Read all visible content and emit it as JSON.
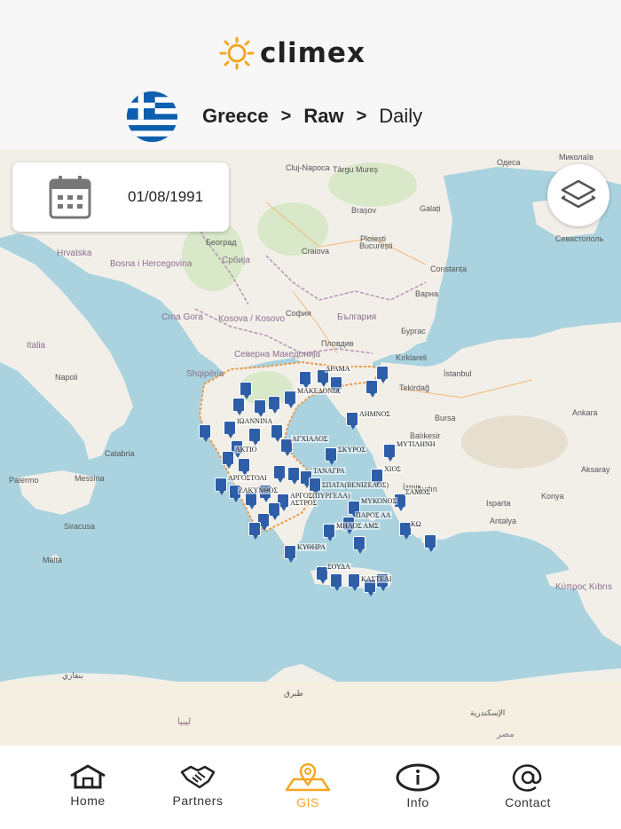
{
  "header": {
    "brand": "climex",
    "breadcrumb": {
      "country": "Greece",
      "source": "Raw",
      "frequency": "Daily",
      "separator": ">"
    }
  },
  "date_picker": {
    "value": "01/08/1991"
  },
  "map": {
    "labels": {
      "odesa": "Одеса",
      "mykolaiv": "Миколаїв",
      "sevastopol": "Севастополь",
      "cluj": "Cluj-Napoca",
      "tirgumures": "Târgu Mureș",
      "brasov": "Brașov",
      "galati": "Galați",
      "ploiesti": "Ploiești",
      "bucuresti": "București",
      "constanta": "Constanța",
      "craiova": "Craiova",
      "varna": "Варна",
      "sofia": "София",
      "bulgaria": "България",
      "plovdiv": "Пловдив",
      "burgas": "Бургас",
      "beograd": "Београд",
      "srbija": "Србија",
      "hrvatska": "Hrvatska",
      "bosna": "Bosna i Hercegovina",
      "crnagora": "Crna Gora",
      "kosovo": "Kosova / Kosovo",
      "shqiperia": "Shqipëria",
      "makedonija": "Северна Македонија",
      "italia": "Italia",
      "napoli": "Napoli",
      "palermo": "Palermo",
      "messina": "Messina",
      "siracusa": "Siracusa",
      "malta": "Malta",
      "calabria": "Calabria",
      "kirklareli": "Kırklareli",
      "istanbul": "İstanbul",
      "tekirdag": "Tekirdağ",
      "bursa": "Bursa",
      "balikesir": "Balıkesir",
      "ankara": "Ankara",
      "izmir": "İzmir",
      "aydin": "Aydın",
      "isparta": "Isparta",
      "antalya": "Antalya",
      "konya": "Konya",
      "aksaray": "Aksaray",
      "kibris": "Κύπρος Kıbrıs",
      "misr": "مصر",
      "libya": "ليبيا",
      "iskandariya": "الإسكندرية",
      "tubruq": "طبرق",
      "benghazi": "بنغازي"
    },
    "stations": {
      "drama": "ΔΡΑΜΑ",
      "makedonia": "ΜΑΚΕΔΟΝΙΑ",
      "limnos": "ΛΗΜΝΟΣ",
      "ioannina": "ΙΩΑΝΝΙΝΑ",
      "agxialos": "ΑΓΧΙΑΛΟΣ",
      "aktio": "ΑΚΤΙΟ",
      "skyros": "ΣΚΥΡΟΣ",
      "mytilini": "ΜΥΤΙΛΗΝΗ",
      "argostoli": "ΑΡΓΟΣΤΟΛΙ",
      "tanagra": "ΤΑΝΑΓΡΑ",
      "chios": "ΧΙΟΣ",
      "spata": "ΣΠΑΤΑ(ΒΕΝΙΖΕΛΟΣ)",
      "zakynthos": "ΖΑΚΥΝΘΟΣ",
      "argos": "ΑΡΓΟΣ(ΠΥΡΓΕΛΑ)",
      "samos": "ΣΑΜΟΣ",
      "astros": "ΑΣΤΡΟΣ",
      "mykonos": "ΜΥΚΟΝΟΣ",
      "paros": "ΠΑΡΟΣ ΑΛ",
      "milos": "ΜΗΛΟΣ ΑΜΣ",
      "kos": "ΚΩ",
      "kythira": "ΚΥΘΗΡΑ",
      "souda": "ΣΟΥΔΑ",
      "kasteli": "ΚΑΣΤΕΛΙ"
    }
  },
  "nav": [
    {
      "label": "Home",
      "icon": "home-icon"
    },
    {
      "label": "Partners",
      "icon": "handshake-icon"
    },
    {
      "label": "GIS",
      "icon": "map-pin-icon"
    },
    {
      "label": "Info",
      "icon": "info-icon"
    },
    {
      "label": "Contact",
      "icon": "at-icon"
    }
  ],
  "colors": {
    "accent": "#f5a623",
    "station": "#2f5ea8",
    "sea": "#aad3df",
    "land": "#f2efe9"
  }
}
